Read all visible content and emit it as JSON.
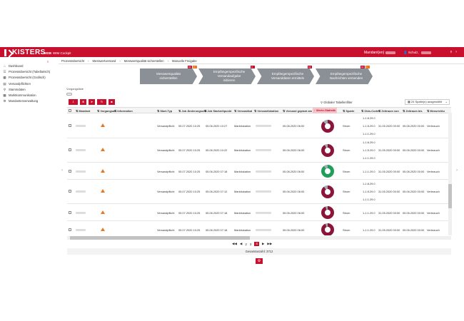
{
  "header": {
    "brand": "KISTERS",
    "app_name": "MSB",
    "app_sub": "WIM Cockpit",
    "tenant_label": "Mandant(en)",
    "user_label": "Schulz, ",
    "icons": [
      "bell-icon",
      "help-icon"
    ]
  },
  "sidebar": {
    "items": [
      {
        "label": "Dashboard",
        "icon": "home-icon"
      },
      {
        "label": "Prozessübersicht (Tabellarisch)",
        "icon": "list-icon"
      },
      {
        "label": "Prozessübersicht (Grafisch)",
        "icon": "chart-icon"
      },
      {
        "label": "Versandpflichten",
        "icon": "doc-icon"
      },
      {
        "label": "Stammdaten",
        "icon": "search-icon"
      },
      {
        "label": "Marktkommunikation",
        "icon": "grid-icon"
      },
      {
        "label": "Mandantenverwaltung",
        "icon": "gear-icon"
      }
    ]
  },
  "breadcrumb": [
    "Prozessübersicht",
    "Messwertversand",
    "Messwertqualität sicherstellen",
    "Manuelle Freigabe"
  ],
  "steps": [
    {
      "line1": "Messwertqualität",
      "line2": "sicherstellen",
      "badges": [
        "10",
        "2"
      ]
    },
    {
      "line1": "Empfängerspezifische",
      "line2": "Versandaufgabe",
      "line3": "initiieren",
      "badges": [
        "4"
      ]
    },
    {
      "line1": "Empfängerspezifische",
      "line2": "Versanddaten ermitteln",
      "badges": [
        "14"
      ]
    },
    {
      "line1": "Empfängerspezifische",
      "line2": "Nachrichten versenden",
      "badges": [
        "10",
        "1"
      ]
    }
  ],
  "vorgang_label": "Vorgangsliste",
  "filter_label": "Globaler Tabellenfilter",
  "columns_selected": "24 Spalte(n) ausgewählt",
  "columns": [
    "Mandant",
    "Vorgangsart",
    "Information",
    "Start-Typ",
    "Job Änderungszeit",
    "Job Startzeitpunkt",
    "Versandkat",
    "Versandlokation",
    "Versand geplant am",
    "Werte-Statistik",
    "Sparte",
    "Obis-Codes",
    "Zeitraum von",
    "Zeitraum bis",
    "Messrichtu"
  ],
  "rows": [
    {
      "start_typ": "Versandpflicht",
      "job_aend": "05.07.2020 10:25",
      "job_start": "05.06.2020 10:27",
      "versandkat": "Marktlokation",
      "versand_geplant": "05.06.2020 06:00",
      "sparte": "Strom",
      "obis": [
        "1-1:8.29.0",
        "1-1:5.29.0",
        "1-1:1.29.0"
      ],
      "von": "31.05.2020 00:00",
      "bis": "05.06.2020 00:00",
      "messrichtung": "Verbrauch",
      "status": "red"
    },
    {
      "start_typ": "Versandpflicht",
      "job_aend": "05.07.2020 10:25",
      "job_start": "05.06.2020 10:22",
      "versandkat": "Marktlokation",
      "versand_geplant": "05.06.2020 06:00",
      "sparte": "Strom",
      "obis": [
        "1-1:8.29.0",
        "1-1:5.29.0",
        "1-1:1.29.0"
      ],
      "von": "31.05.2020 00:00",
      "bis": "05.06.2020 00:00",
      "messrichtung": "Verbrauch",
      "status": "red"
    },
    {
      "start_typ": "Versandpflicht",
      "job_aend": "05.07.2020 10:25",
      "job_start": "05.06.2020 07:18",
      "versandkat": "Marktlokation",
      "versand_geplant": "05.06.2020 06:00",
      "sparte": "Strom",
      "obis": [
        "1-1:1.29.0"
      ],
      "von": "31.05.2020 00:00",
      "bis": "05.06.2020 00:00",
      "messrichtung": "Verbrauch",
      "status": "green"
    },
    {
      "start_typ": "Versandpflicht",
      "job_aend": "05.07.2020 10:25",
      "job_start": "05.06.2020 07:12",
      "versandkat": "Marktlokation",
      "versand_geplant": "05.06.2020 06:00",
      "sparte": "Strom",
      "obis": [
        "1-1:8.29.0",
        "1-1:5.29.0",
        "1-1:1.29.0"
      ],
      "von": "31.05.2020 00:00",
      "bis": "05.06.2020 00:00",
      "messrichtung": "Verbrauch",
      "status": "red"
    },
    {
      "start_typ": "Versandpflicht",
      "job_aend": "05.07.2020 10:25",
      "job_start": "05.06.2020 07:18",
      "versandkat": "Marktlokation",
      "versand_geplant": "05.06.2020 06:00",
      "sparte": "Strom",
      "obis": [
        "1-1:1.29.0"
      ],
      "von": "31.05.2020 00:00",
      "bis": "05.06.2020 00:00",
      "messrichtung": "Verbrauch",
      "status": "red"
    },
    {
      "start_typ": "Versandpflicht",
      "job_aend": "05.07.2020 10:25",
      "job_start": "05.06.2020 07:18",
      "versandkat": "Marktlokation",
      "versand_geplant": "05.06.2020 06:00",
      "sparte": "Strom",
      "obis": [
        "1-1:1.29.0"
      ],
      "von": "31.05.2020 00:00",
      "bis": "05.06.2020 00:00",
      "messrichtung": "Verbrauch",
      "status": "red"
    }
  ],
  "pager": {
    "pages": [
      "2",
      "3",
      "4"
    ],
    "current": "4"
  },
  "total": "Gesamtanzahl: 3712",
  "colors": {
    "accent": "#c8102e",
    "warning": "#e87722",
    "ok": "#1e9e5a",
    "step": "#8a9095"
  }
}
